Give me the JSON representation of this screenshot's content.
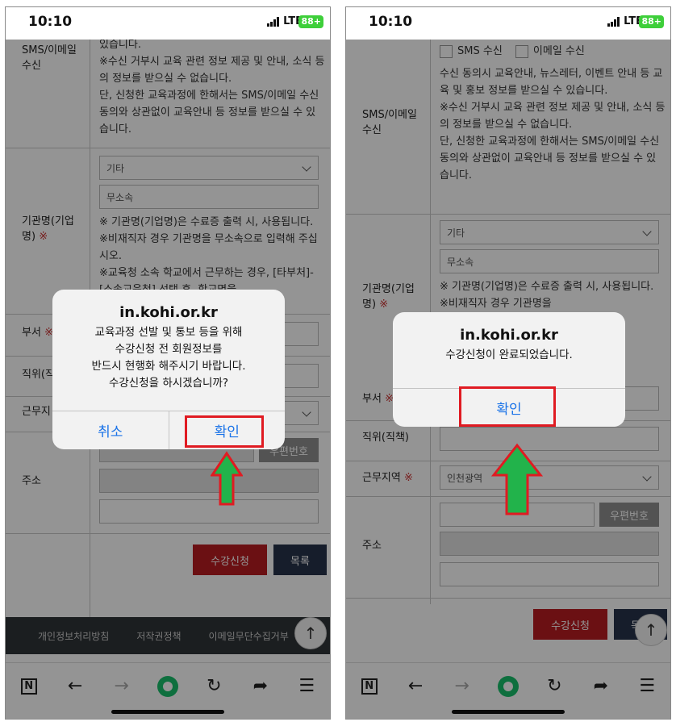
{
  "status": {
    "time": "10:10",
    "network": "LTE",
    "battery": "88+"
  },
  "form": {
    "sms_label": "SMS/이메일 수신",
    "sms_option": "SMS 수신",
    "email_option": "이메일 수신",
    "consent_text_full": "수신 동의시 교육안내, 뉴스레터, 이벤트 안내 등 교육 및 홍보 정보를 받으실 수 있습니다.\n※수신 거부시 교육 관련 정보 제공 및 안내, 소식 등의 정보를 받으실 수 없습니다.\n단, 신청한 교육과정에 한해서는 SMS/이메일 수신 동의와 상관없이 교육안내 등 정보를 받으실 수 있습니다.",
    "consent_text_partial": "있습니다.\n※수신 거부시 교육 관련 정보 제공 및 안내, 소식 등의 정보를 받으실 수 없습니다.\n단, 신청한 교육과정에 한해서는 SMS/이메일 수신 동의와 상관없이 교육안내 등 정보를 받으실 수 있습니다.",
    "org_label": "기관명(기업명)",
    "org_select": "기타",
    "org_value": "무소속",
    "org_note_full": "※ 기관명(기업명)은 수료증 출력 시, 사용됩니다. ※비재직자 경우 기관명을 무소속으로 입력해 주십시오.\n※교육청 소속 학교에서 근무하는 경우, [타부처]-[소속교육청] 선택 후, 학교명을",
    "org_note_short": "※ 기관명(기업명)은 수료증 출력 시, 사용됩니다. ※비재직자 경우 기관명을",
    "dept_label": "부서",
    "position_label": "직위(직책)",
    "position_label_cut": "직위(직",
    "region_label": "근무지역",
    "region_label_cut": "근무지",
    "region_select": "인천광역",
    "zip_button": "우편번호",
    "address_label": "주소",
    "required_mark": "※"
  },
  "buttons": {
    "apply": "수강신청",
    "list": "목록"
  },
  "footer": {
    "items": [
      "개인정보처리방침",
      "저작권정책",
      "이메일무단수집거부"
    ]
  },
  "toolbar": {
    "icons": [
      "naver-icon",
      "back-icon",
      "forward-icon",
      "home-icon",
      "refresh-icon",
      "share-icon",
      "menu-icon"
    ]
  },
  "dialog_left": {
    "title": "in.kohi.or.kr",
    "message": "교육과정 선발 및 통보 등을 위해\n수강신청 전 회원정보를\n반드시 현행화 해주시기 바랍니다.\n수강신청을 하시겠습니까?",
    "cancel": "취소",
    "confirm": "확인"
  },
  "dialog_right": {
    "title": "in.kohi.or.kr",
    "message": "수강신청이 완료되었습니다.",
    "confirm": "확인"
  },
  "colors": {
    "accent_red": "#e01b22",
    "arrow_green": "#22b34b",
    "link_blue": "#1a73e8"
  }
}
